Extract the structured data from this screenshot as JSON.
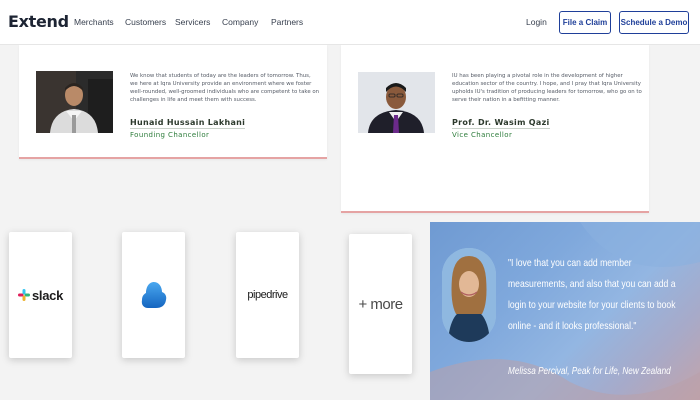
{
  "nav": {
    "logo": "Extend",
    "links": [
      "Merchants",
      "Customers",
      "Servicers",
      "Company",
      "Partners"
    ],
    "login": "Login",
    "file_claim": "File a Claim",
    "schedule_demo": "Schedule a Demo"
  },
  "cards": [
    {
      "text": "We know that students of today are the leaders of tomorrow. Thus, we here at Iqra University provide an environment where we foster well-rounded, well-groomed individuals who are competent to take on challenges in life and meet them with success.",
      "name": "Hunaid Hussain Lakhani",
      "role": "Founding Chancellor"
    },
    {
      "text": "IU has been playing a pivotal role in the development of higher education sector of the country. I hope, and I pray that Iqra University upholds IU's tradition of producing leaders for tomorrow, who go on to serve their nation in a befitting manner.",
      "name": "Prof. Dr. Wasim Qazi",
      "role": "Vice Chancellor"
    }
  ],
  "integrations": [
    {
      "label": "slack",
      "icon": "slack-logo-icon"
    },
    {
      "label": "",
      "icon": "onedrive-cloud-icon"
    },
    {
      "label": "pipedrive",
      "icon": "pipedrive-logo-icon"
    },
    {
      "label": "+ more",
      "icon": ""
    }
  ],
  "quote": {
    "text": "\"I love that you can add member measurements, and also that you can add a login to your website for your clients to book online - and it looks professional.\"",
    "author": "Melissa Percival, Peak for Life, New Zealand"
  },
  "colors": {
    "brand_blue": "#1f3f99",
    "card_accent": "#e5a3a3",
    "role_green": "#2e7d3c",
    "slack_colors": [
      "#36c5f0",
      "#2eb67d",
      "#ecb22e",
      "#e01e5a"
    ],
    "onedrive_blue": "#1e88e5"
  }
}
